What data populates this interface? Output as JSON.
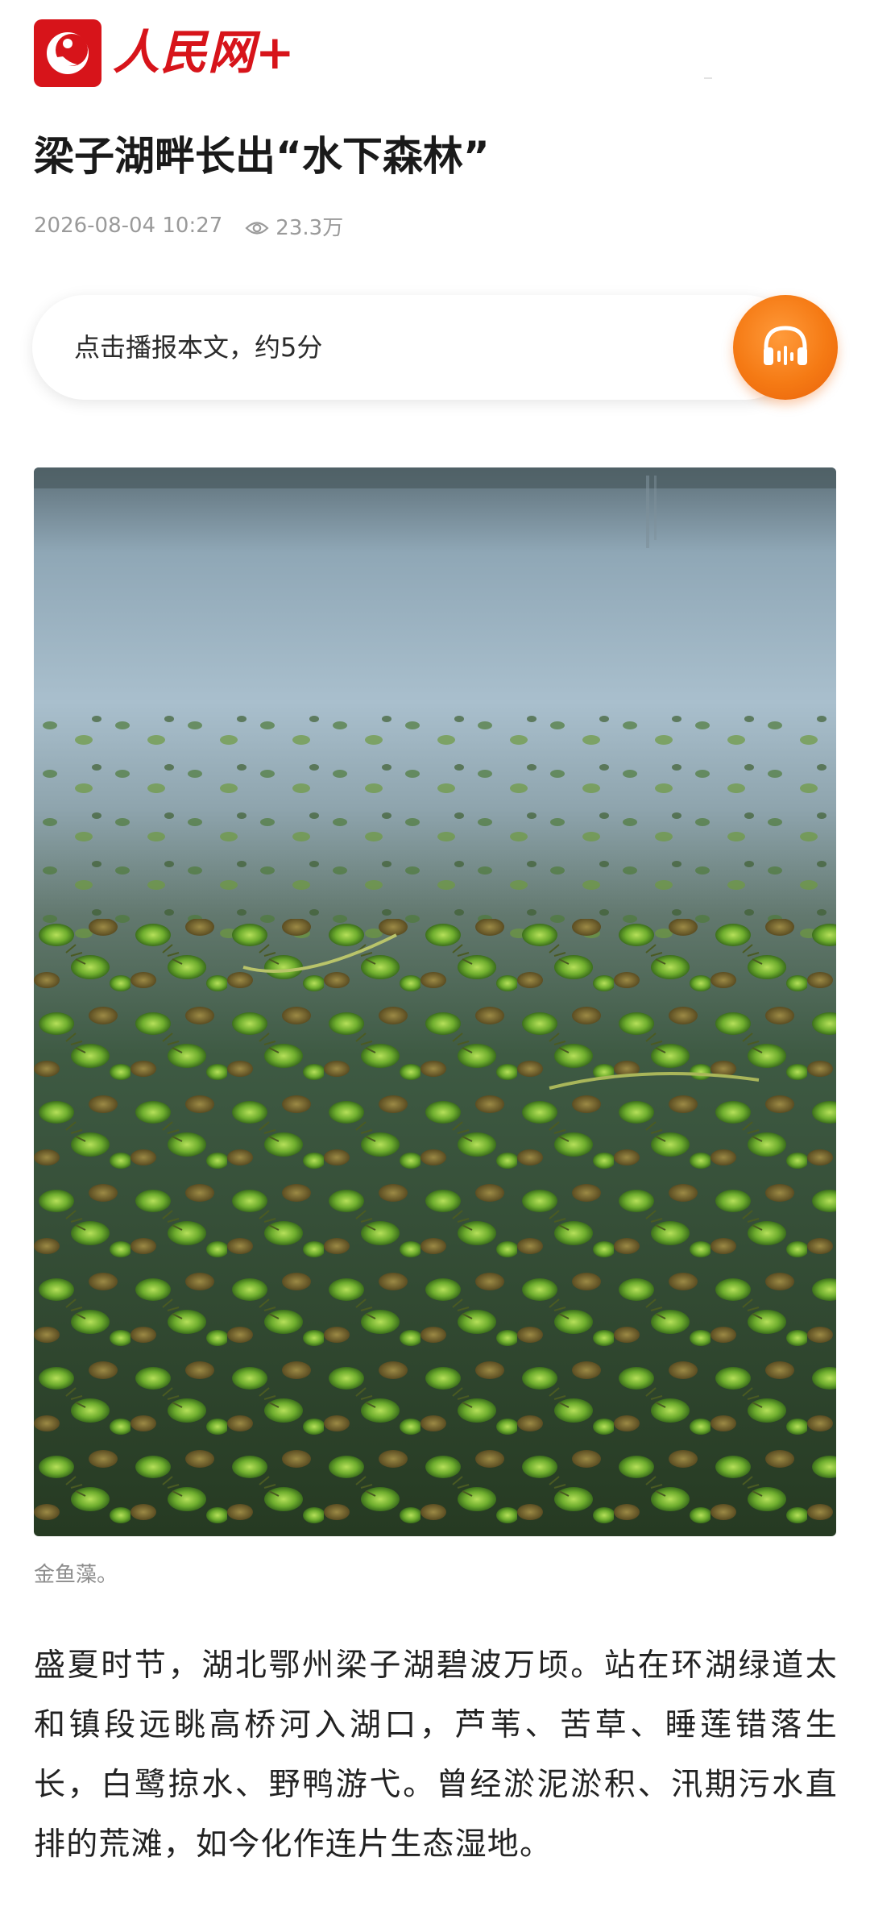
{
  "header": {
    "brand_name": "人民网+",
    "logo_icon": "peoples-daily-logo-icon",
    "brand_color": "#d7141a"
  },
  "article": {
    "title": "梁子湖畔长出“水下森林”",
    "date": "2026-08-04 10:27",
    "views": "23.3万",
    "view_icon": "eye-icon"
  },
  "audio": {
    "label": "点击播报本文，约5分",
    "button_icon": "headphones-icon",
    "accent_color": "#f57a14"
  },
  "photo": {
    "caption": "金鱼藻。"
  },
  "body": {
    "paragraph_1": "盛夏时节，湖北鄂州梁子湖碧波万顷。站在环湖绿道太和镇段远眺高桥河入湖口，芦苇、苦草、睡莲错落生长，白鹭掠水、野鸭游弋。曾经淤泥淤积、汛期污水直排的荒滩，如今化作连片生态湿地。"
  }
}
